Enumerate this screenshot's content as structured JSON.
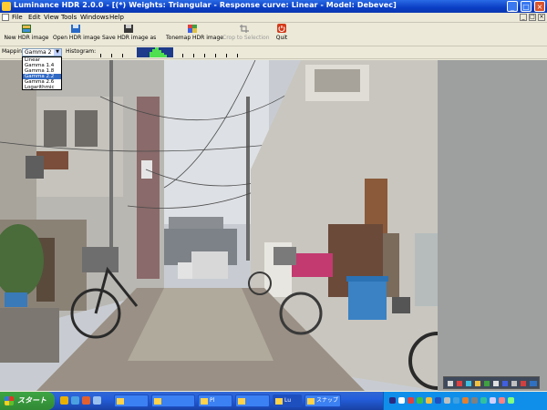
{
  "titlebar": {
    "title": "Luminance HDR 2.0.0 - [(*) Weights: Triangular - Response curve: Linear - Model: Debevec]"
  },
  "menubar": {
    "items": [
      "File",
      "Edit",
      "View",
      "Tools",
      "Windows",
      "Help"
    ]
  },
  "toolbar": {
    "buttons": [
      {
        "label": "New HDR image",
        "icon": "new-hdr-icon"
      },
      {
        "label": "Open HDR image",
        "icon": "open-icon"
      },
      {
        "label": "Save HDR image as",
        "icon": "save-icon"
      },
      {
        "label": "Tonemap HDR image",
        "icon": "tonemap-icon"
      },
      {
        "label": "Crop to Selection",
        "icon": "crop-icon"
      },
      {
        "label": "Quit",
        "icon": "quit-icon"
      }
    ]
  },
  "mapbar": {
    "mapping_label": "Mapping:",
    "mapping_value": "Gamma 2",
    "histogram_label": "Histogram:"
  },
  "mapping_options": [
    "Linear",
    "Gamma 1.4",
    "Gamma 1.8",
    "Gamma 2.2",
    "Gamma 2.6",
    "Logarithmic"
  ],
  "mapping_selected_index": 3,
  "taskbar": {
    "start_label": "スタート",
    "tasks": [
      {
        "label": ""
      },
      {
        "label": ""
      },
      {
        "label": "Pl"
      },
      {
        "label": ""
      },
      {
        "label": "Lu"
      },
      {
        "label": "スナップ"
      }
    ]
  },
  "colors": {
    "titlebar_blue": "#0a3ec5",
    "taskbar_blue": "#245edb",
    "start_green": "#3ea543",
    "selection_blue": "#316ac5",
    "histogram_bg": "#1e3a8a",
    "histogram_fg": "#4fe04f"
  }
}
